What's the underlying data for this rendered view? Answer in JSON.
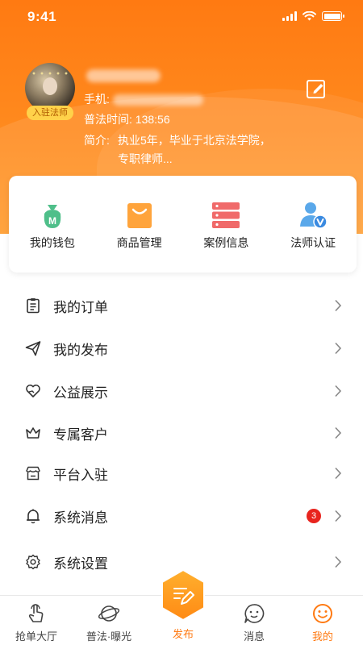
{
  "status_bar": {
    "time": "9:41"
  },
  "profile": {
    "badge": "入驻法师",
    "phone_label": "手机:",
    "time_label": "普法时间:",
    "time_value": "138:56",
    "intro_label": "简介:",
    "intro_text": "执业5年，毕业于北京法学院，专职律师..."
  },
  "quick_actions": [
    {
      "label": "我的钱包",
      "icon": "money-bag-icon"
    },
    {
      "label": "商品管理",
      "icon": "shopping-bag-icon"
    },
    {
      "label": "案例信息",
      "icon": "server-list-icon"
    },
    {
      "label": "法师认证",
      "icon": "verified-user-icon"
    }
  ],
  "menu": [
    {
      "label": "我的订单",
      "icon": "clipboard-icon"
    },
    {
      "label": "我的发布",
      "icon": "send-icon"
    },
    {
      "label": "公益展示",
      "icon": "heart-hand-icon"
    },
    {
      "label": "专属客户",
      "icon": "crown-icon"
    },
    {
      "label": "平台入驻",
      "icon": "store-icon"
    },
    {
      "label": "系统消息",
      "icon": "bell-icon",
      "count": "3"
    },
    {
      "label": "系统设置",
      "icon": "gear-icon"
    }
  ],
  "tabbar": [
    {
      "label": "抢单大厅",
      "icon": "hand-tap-icon"
    },
    {
      "label": "普法·曝光",
      "icon": "planet-icon"
    },
    {
      "label": "发布",
      "icon": "publish-pen-icon"
    },
    {
      "label": "消息",
      "icon": "chat-smile-icon"
    },
    {
      "label": "我的",
      "icon": "smile-icon",
      "active": true
    }
  ],
  "colors": {
    "accent": "#ff7a12",
    "badge": "#e8241e"
  }
}
